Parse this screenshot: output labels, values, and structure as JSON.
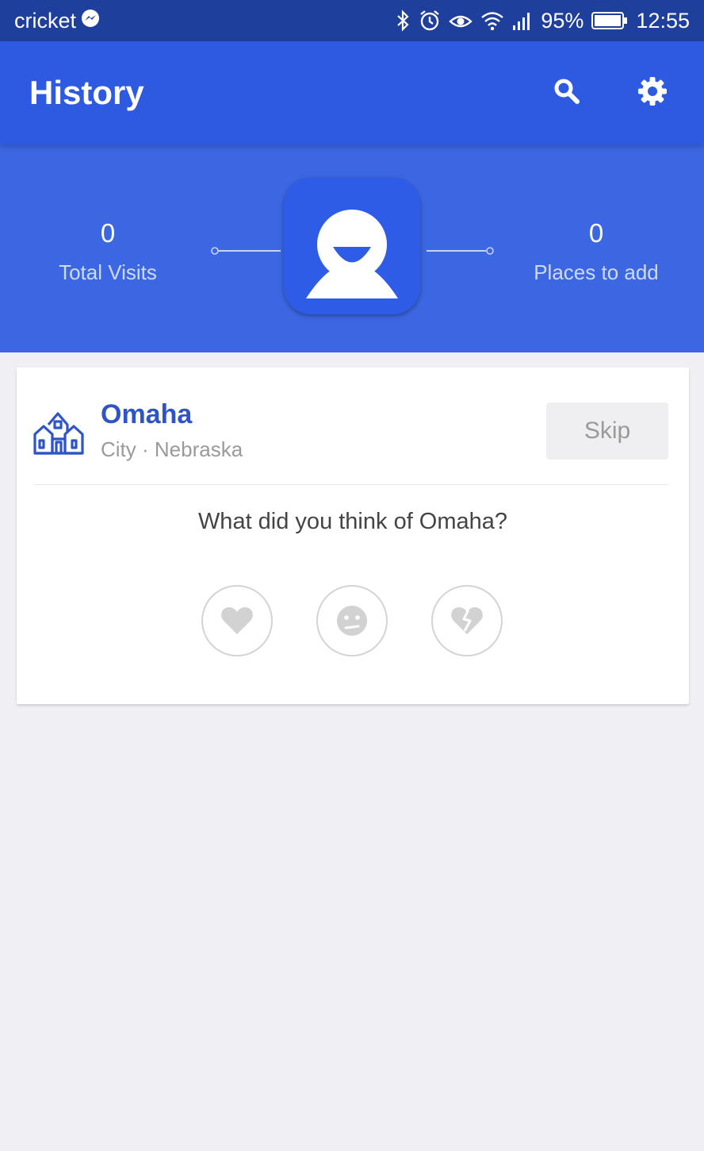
{
  "status_bar": {
    "carrier": "cricket",
    "battery": "95%",
    "time": "12:55",
    "icons": [
      "messenger-icon",
      "bluetooth-icon",
      "alarm-icon",
      "eye-icon",
      "wifi-icon",
      "signal-icon",
      "battery-icon"
    ]
  },
  "app_bar": {
    "title": "History",
    "actions": [
      "search-icon",
      "settings-icon"
    ]
  },
  "stats": {
    "total_visits_value": "0",
    "total_visits_label": "Total Visits",
    "places_to_add_value": "0",
    "places_to_add_label": "Places to add"
  },
  "card": {
    "place_name": "Omaha",
    "place_meta": "City · Nebraska",
    "skip_label": "Skip",
    "question": "What did you think of Omaha?",
    "reactions": [
      "heart-icon",
      "neutral-face-icon",
      "broken-heart-icon"
    ]
  },
  "colors": {
    "status_bar": "#1f3f9c",
    "app_bar": "#2d5ae0",
    "stats_band": "#3c67e3",
    "accent_text": "#2d55c8",
    "background": "#efeff4"
  }
}
